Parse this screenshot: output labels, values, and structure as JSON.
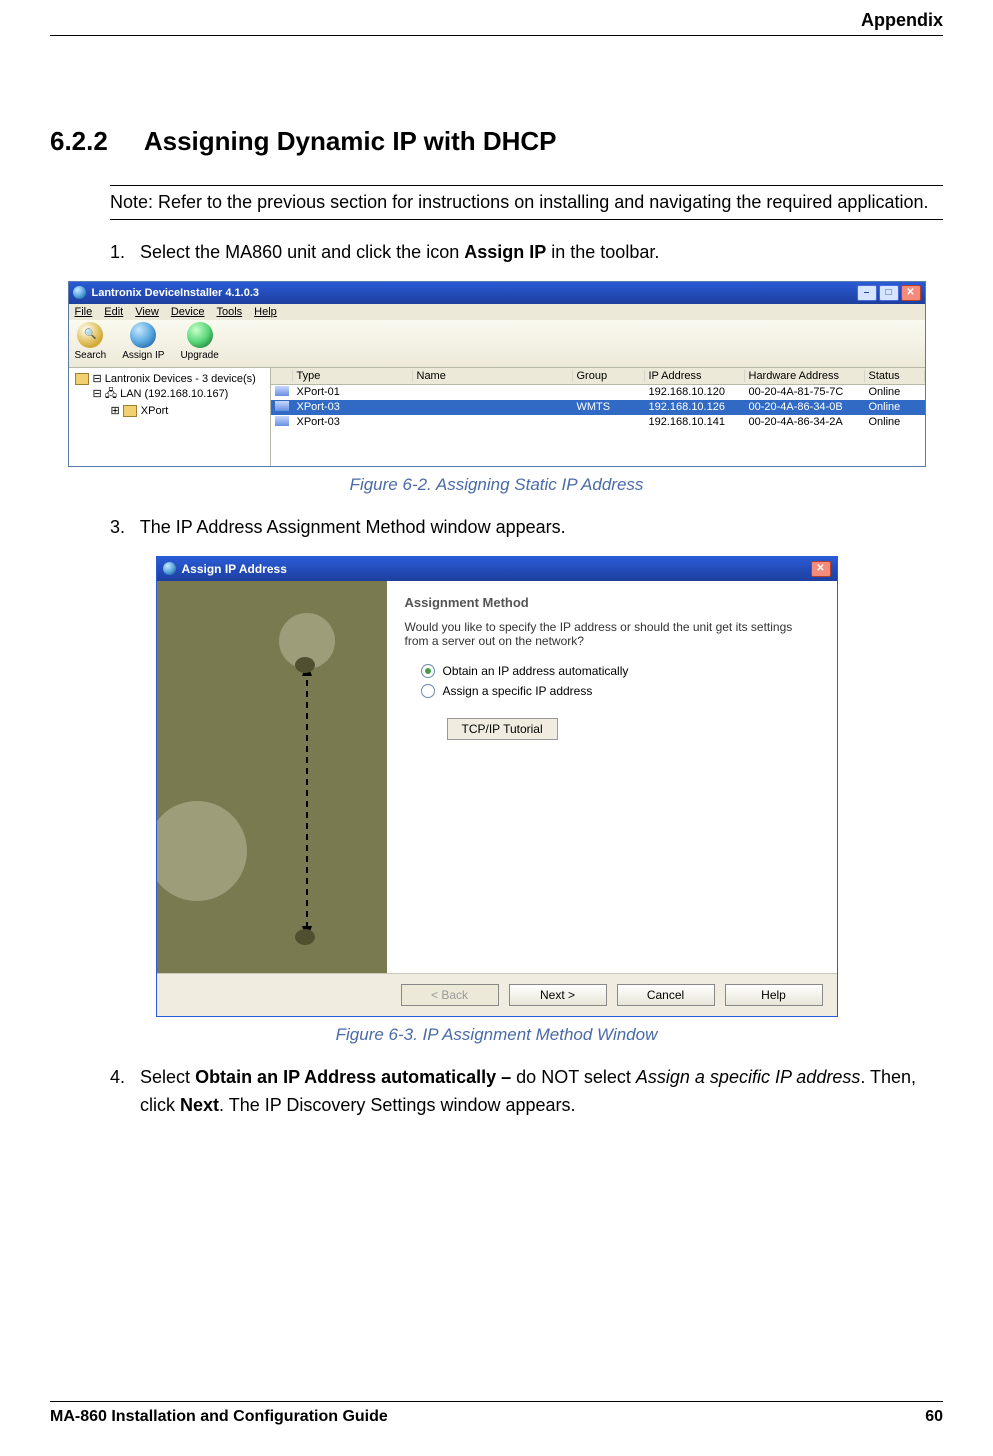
{
  "header": {
    "label": "Appendix"
  },
  "section": {
    "number": "6.2.2",
    "title": "Assigning Dynamic IP with DHCP"
  },
  "note": "Note: Refer to the previous section for instructions on installing and navigating the required application.",
  "steps": [
    {
      "num": "1.",
      "pre": "Select the MA860 unit and click the icon ",
      "bold": "Assign IP",
      "post": " in the toolbar."
    },
    {
      "num": "3.",
      "text": "The IP Address Assignment Method window appears."
    },
    {
      "num": "4.",
      "pre": "Select ",
      "bold1": "Obtain an IP Address automatically – ",
      "mid1": "do NOT select ",
      "italic": "Assign a specific IP address",
      "mid2": ". Then, click ",
      "bold2": "Next",
      "post": ". The IP Discovery Settings window appears."
    }
  ],
  "captions": [
    "Figure 6-2. Assigning Static IP Address",
    "Figure 6-3. IP Assignment Method Window"
  ],
  "di": {
    "title": "Lantronix DeviceInstaller 4.1.0.3",
    "menu": [
      "File",
      "Edit",
      "View",
      "Device",
      "Tools",
      "Help"
    ],
    "toolbar": [
      "Search",
      "Assign IP",
      "Upgrade"
    ],
    "tree": {
      "root": "Lantronix Devices - 3 device(s)",
      "lan": "🖧 LAN (192.168.10.167)",
      "xport": "XPort"
    },
    "columns": [
      "Type",
      "Name",
      "Group",
      "IP Address",
      "Hardware Address",
      "Status"
    ],
    "rows": [
      {
        "type": "XPort-01",
        "name": "",
        "group": "",
        "ip": "192.168.10.120",
        "hw": "00-20-4A-81-75-7C",
        "status": "Online"
      },
      {
        "type": "XPort-03",
        "name": "",
        "group": "WMTS",
        "ip": "192.168.10.126",
        "hw": "00-20-4A-86-34-0B",
        "status": "Online"
      },
      {
        "type": "XPort-03",
        "name": "",
        "group": "",
        "ip": "192.168.10.141",
        "hw": "00-20-4A-86-34-2A",
        "status": "Online"
      }
    ]
  },
  "wiz": {
    "title": "Assign IP Address",
    "heading": "Assignment Method",
    "question": "Would you like to specify the IP address or should the unit get its settings from a server out on the network?",
    "radios": [
      "Obtain an IP address automatically",
      "Assign a specific IP address"
    ],
    "tutorial": "TCP/IP Tutorial",
    "buttons": [
      "< Back",
      "Next >",
      "Cancel",
      "Help"
    ]
  },
  "footer": {
    "title": "MA-860 Installation and Configuration Guide",
    "page": "60"
  }
}
